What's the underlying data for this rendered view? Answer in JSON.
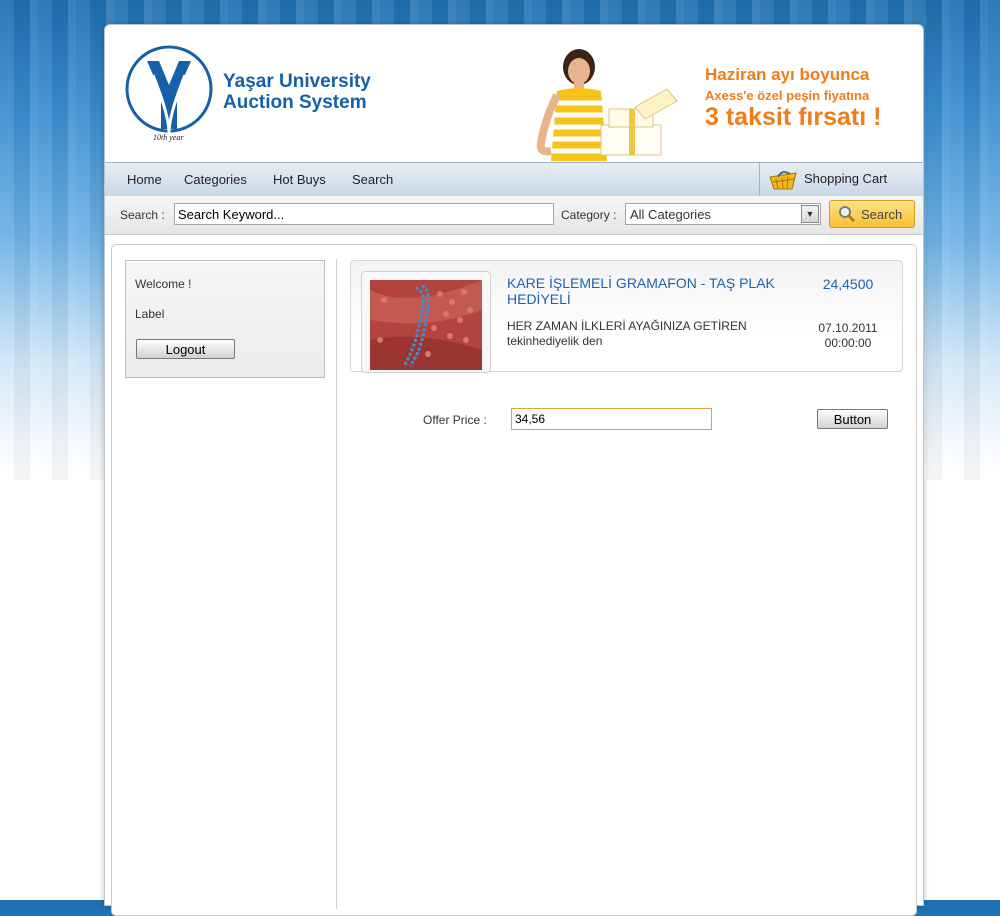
{
  "brand": {
    "line1": "Yaşar University",
    "line2": "Auction System",
    "logo_caption": "10th year"
  },
  "promo": {
    "line1": "Haziran ayı boyunca",
    "line2": "Axess'e özel peşin fiyatına",
    "line3": "3 taksit fırsatı !"
  },
  "nav": {
    "items": [
      "Home",
      "Categories",
      "Hot Buys",
      "Search"
    ],
    "cart": "Shopping Cart"
  },
  "search": {
    "label": "Search :",
    "keyword": "Search Keyword...",
    "category_label": "Category :",
    "category_selected": "All Categories",
    "button": "Search"
  },
  "sidebar": {
    "welcome": "Welcome !",
    "label": "Label",
    "logout": "Logout"
  },
  "product": {
    "title": "KARE İŞLEMELİ GRAMAFON - TAŞ PLAK HEDİYELİ",
    "description": "HER ZAMAN İLKLERİ AYAĞINIZA GETİREN tekinhediyelik den",
    "price": "24,4500",
    "date": "07.10.2011",
    "time": "00:00:00"
  },
  "offer": {
    "label": "Offer Price :",
    "value": "34,56",
    "button": "Button"
  },
  "colors": {
    "accent_blue": "#1d63ad",
    "promo_orange": "#f07d16",
    "search_yellow": "#f6c034"
  }
}
